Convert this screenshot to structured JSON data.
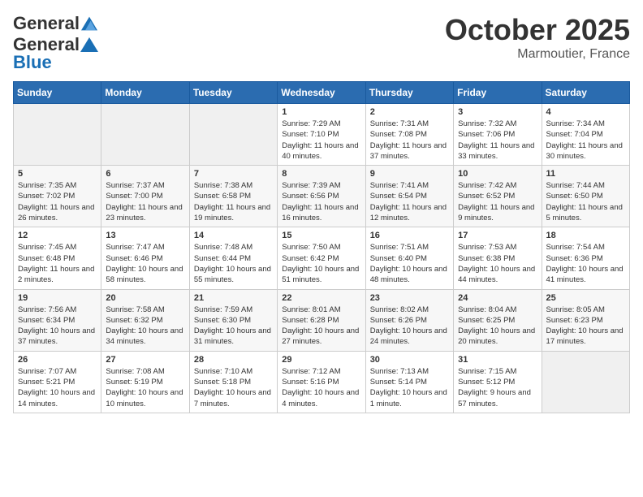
{
  "header": {
    "logo_general": "General",
    "logo_blue": "Blue",
    "month": "October 2025",
    "location": "Marmoutier, France"
  },
  "days_of_week": [
    "Sunday",
    "Monday",
    "Tuesday",
    "Wednesday",
    "Thursday",
    "Friday",
    "Saturday"
  ],
  "weeks": [
    [
      {
        "day": "",
        "info": ""
      },
      {
        "day": "",
        "info": ""
      },
      {
        "day": "",
        "info": ""
      },
      {
        "day": "1",
        "info": "Sunrise: 7:29 AM\nSunset: 7:10 PM\nDaylight: 11 hours and 40 minutes."
      },
      {
        "day": "2",
        "info": "Sunrise: 7:31 AM\nSunset: 7:08 PM\nDaylight: 11 hours and 37 minutes."
      },
      {
        "day": "3",
        "info": "Sunrise: 7:32 AM\nSunset: 7:06 PM\nDaylight: 11 hours and 33 minutes."
      },
      {
        "day": "4",
        "info": "Sunrise: 7:34 AM\nSunset: 7:04 PM\nDaylight: 11 hours and 30 minutes."
      }
    ],
    [
      {
        "day": "5",
        "info": "Sunrise: 7:35 AM\nSunset: 7:02 PM\nDaylight: 11 hours and 26 minutes."
      },
      {
        "day": "6",
        "info": "Sunrise: 7:37 AM\nSunset: 7:00 PM\nDaylight: 11 hours and 23 minutes."
      },
      {
        "day": "7",
        "info": "Sunrise: 7:38 AM\nSunset: 6:58 PM\nDaylight: 11 hours and 19 minutes."
      },
      {
        "day": "8",
        "info": "Sunrise: 7:39 AM\nSunset: 6:56 PM\nDaylight: 11 hours and 16 minutes."
      },
      {
        "day": "9",
        "info": "Sunrise: 7:41 AM\nSunset: 6:54 PM\nDaylight: 11 hours and 12 minutes."
      },
      {
        "day": "10",
        "info": "Sunrise: 7:42 AM\nSunset: 6:52 PM\nDaylight: 11 hours and 9 minutes."
      },
      {
        "day": "11",
        "info": "Sunrise: 7:44 AM\nSunset: 6:50 PM\nDaylight: 11 hours and 5 minutes."
      }
    ],
    [
      {
        "day": "12",
        "info": "Sunrise: 7:45 AM\nSunset: 6:48 PM\nDaylight: 11 hours and 2 minutes."
      },
      {
        "day": "13",
        "info": "Sunrise: 7:47 AM\nSunset: 6:46 PM\nDaylight: 10 hours and 58 minutes."
      },
      {
        "day": "14",
        "info": "Sunrise: 7:48 AM\nSunset: 6:44 PM\nDaylight: 10 hours and 55 minutes."
      },
      {
        "day": "15",
        "info": "Sunrise: 7:50 AM\nSunset: 6:42 PM\nDaylight: 10 hours and 51 minutes."
      },
      {
        "day": "16",
        "info": "Sunrise: 7:51 AM\nSunset: 6:40 PM\nDaylight: 10 hours and 48 minutes."
      },
      {
        "day": "17",
        "info": "Sunrise: 7:53 AM\nSunset: 6:38 PM\nDaylight: 10 hours and 44 minutes."
      },
      {
        "day": "18",
        "info": "Sunrise: 7:54 AM\nSunset: 6:36 PM\nDaylight: 10 hours and 41 minutes."
      }
    ],
    [
      {
        "day": "19",
        "info": "Sunrise: 7:56 AM\nSunset: 6:34 PM\nDaylight: 10 hours and 37 minutes."
      },
      {
        "day": "20",
        "info": "Sunrise: 7:58 AM\nSunset: 6:32 PM\nDaylight: 10 hours and 34 minutes."
      },
      {
        "day": "21",
        "info": "Sunrise: 7:59 AM\nSunset: 6:30 PM\nDaylight: 10 hours and 31 minutes."
      },
      {
        "day": "22",
        "info": "Sunrise: 8:01 AM\nSunset: 6:28 PM\nDaylight: 10 hours and 27 minutes."
      },
      {
        "day": "23",
        "info": "Sunrise: 8:02 AM\nSunset: 6:26 PM\nDaylight: 10 hours and 24 minutes."
      },
      {
        "day": "24",
        "info": "Sunrise: 8:04 AM\nSunset: 6:25 PM\nDaylight: 10 hours and 20 minutes."
      },
      {
        "day": "25",
        "info": "Sunrise: 8:05 AM\nSunset: 6:23 PM\nDaylight: 10 hours and 17 minutes."
      }
    ],
    [
      {
        "day": "26",
        "info": "Sunrise: 7:07 AM\nSunset: 5:21 PM\nDaylight: 10 hours and 14 minutes."
      },
      {
        "day": "27",
        "info": "Sunrise: 7:08 AM\nSunset: 5:19 PM\nDaylight: 10 hours and 10 minutes."
      },
      {
        "day": "28",
        "info": "Sunrise: 7:10 AM\nSunset: 5:18 PM\nDaylight: 10 hours and 7 minutes."
      },
      {
        "day": "29",
        "info": "Sunrise: 7:12 AM\nSunset: 5:16 PM\nDaylight: 10 hours and 4 minutes."
      },
      {
        "day": "30",
        "info": "Sunrise: 7:13 AM\nSunset: 5:14 PM\nDaylight: 10 hours and 1 minute."
      },
      {
        "day": "31",
        "info": "Sunrise: 7:15 AM\nSunset: 5:12 PM\nDaylight: 9 hours and 57 minutes."
      },
      {
        "day": "",
        "info": ""
      }
    ]
  ]
}
